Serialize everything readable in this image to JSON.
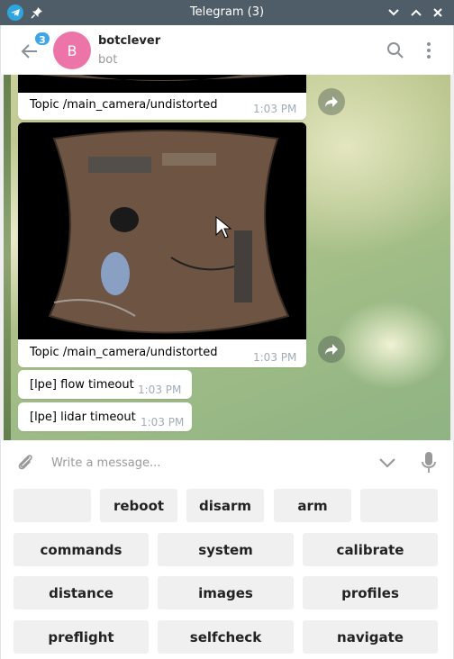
{
  "window": {
    "title": "Telegram (3)"
  },
  "header": {
    "unread_count": "3",
    "avatar_letter": "B",
    "name": "botclever",
    "status": "bot"
  },
  "messages": [
    {
      "caption": "Topic /main_camera/undistorted",
      "time": "1:03 PM"
    },
    {
      "caption": "Topic /main_camera/undistorted",
      "time": "1:03 PM"
    },
    {
      "text": "[lpe] flow timeout",
      "time": "1:03 PM"
    },
    {
      "text": "[lpe] lidar timeout",
      "time": "1:03 PM"
    }
  ],
  "composer": {
    "placeholder": "Write a message..."
  },
  "keyboard": {
    "row1": [
      "",
      "reboot",
      "disarm",
      "arm",
      ""
    ],
    "row2": [
      "commands",
      "system",
      "calibrate"
    ],
    "row3": [
      "distance",
      "images",
      "profiles"
    ],
    "row4": [
      "preflight",
      "selfcheck",
      "navigate"
    ]
  },
  "colors": {
    "titlebar": "#4f5d68",
    "avatar": "#ed74a8",
    "badge": "#3fa5e5",
    "app_icon": "#2da5e0"
  }
}
